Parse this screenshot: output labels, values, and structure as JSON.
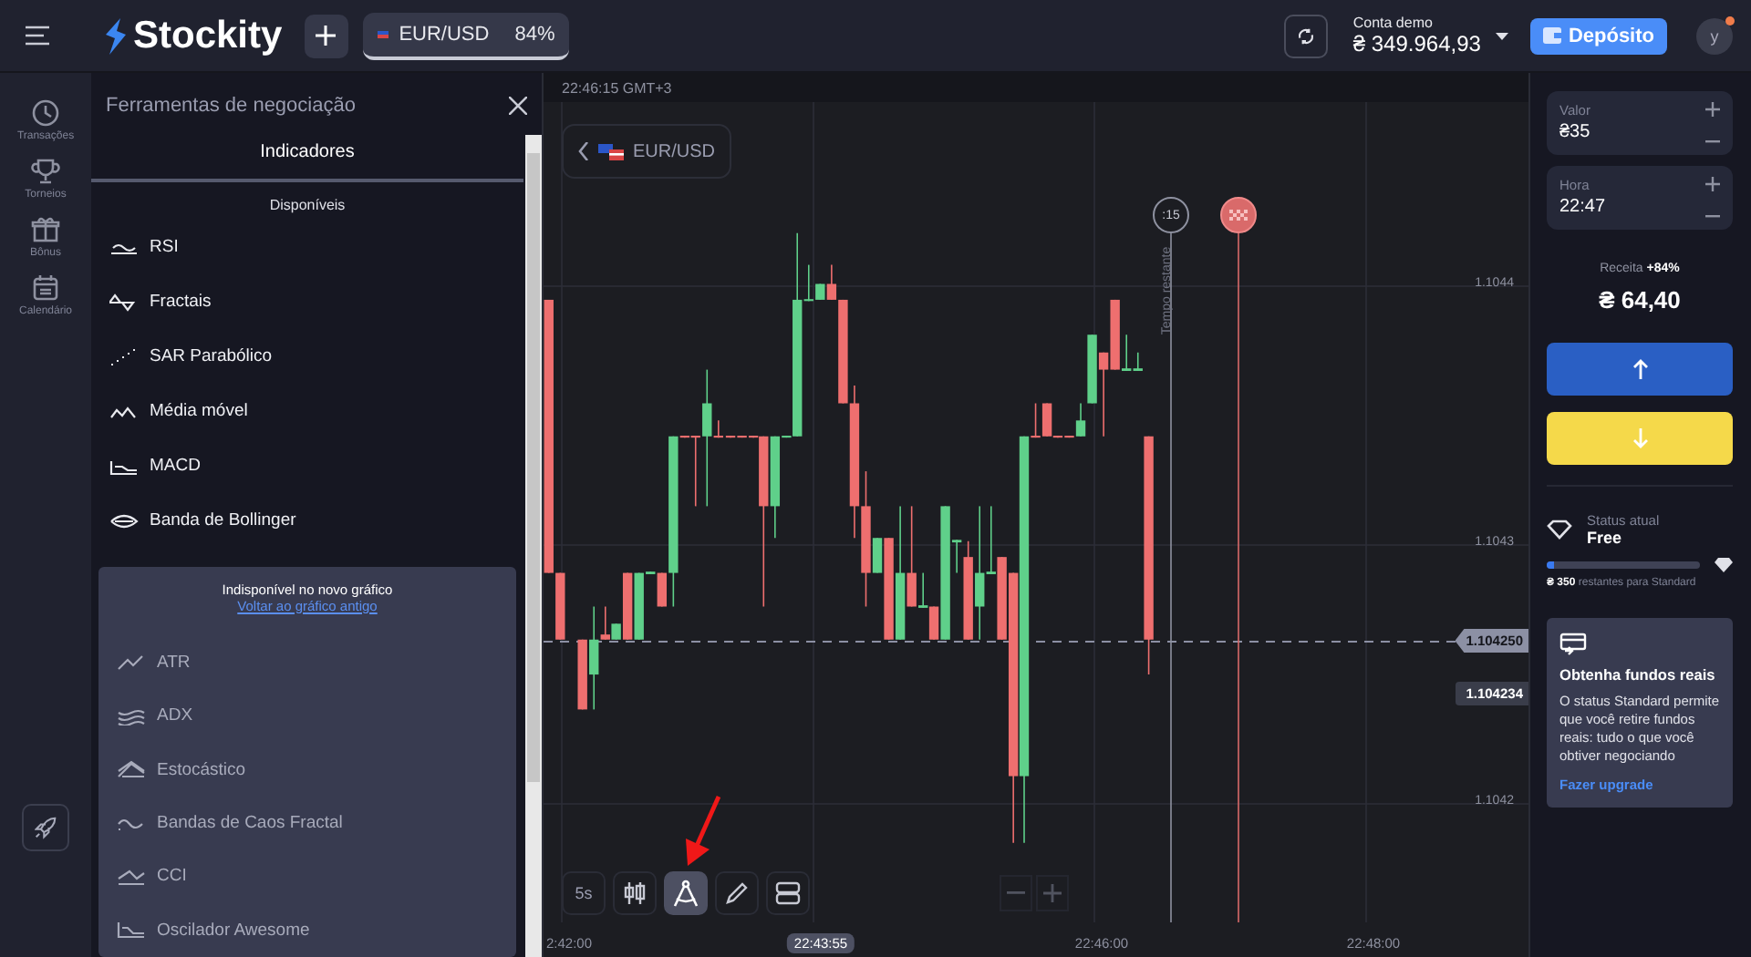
{
  "topbar": {
    "logo": "Stockity",
    "asset_tab": {
      "label": "EUR/USD",
      "payout": "84%",
      "selected": true
    },
    "account": {
      "label": "Conta demo",
      "balance": "₴ 349.964,93"
    },
    "deposit": "Depósito",
    "avatar": "y",
    "notification": true
  },
  "rail": {
    "items": [
      {
        "label": "Transações"
      },
      {
        "label": "Torneios"
      },
      {
        "label": "Bônus"
      },
      {
        "label": "Calendário"
      }
    ]
  },
  "tools_panel": {
    "title": "Ferramentas de negociação",
    "tabs": [
      {
        "label": "Indicadores",
        "selected": true
      }
    ],
    "section": "Disponíveis",
    "available": [
      {
        "label": "RSI"
      },
      {
        "label": "Fractais"
      },
      {
        "label": "SAR Parabólico"
      },
      {
        "label": "Média móvel"
      },
      {
        "label": "MACD"
      },
      {
        "label": "Banda de Bollinger"
      }
    ],
    "unavailable": {
      "title": "Indisponível no novo gráfico",
      "link": "Voltar ao gráfico antigo",
      "items": [
        {
          "label": "ATR"
        },
        {
          "label": "ADX"
        },
        {
          "label": "Estocástico"
        },
        {
          "label": "Bandas de Caos Fractal"
        },
        {
          "label": "CCI"
        },
        {
          "label": "Oscilador Awesome"
        }
      ]
    }
  },
  "chart": {
    "time_header": "22:46:15 GMT+3",
    "asset": "EUR/USD",
    "price_labels": [
      "1.1044",
      "1.1043",
      "1.1042"
    ],
    "current_price": "1.104250",
    "last_price": "1.104234",
    "timer": ":15",
    "timer_label": "Tempo restante",
    "time_labels": [
      {
        "label": "2:42:00",
        "highlighted": false
      },
      {
        "label": "22:43:55",
        "highlighted": true
      },
      {
        "label": "22:46:00",
        "highlighted": false
      },
      {
        "label": "22:48:00",
        "highlighted": false
      }
    ],
    "tools": [
      {
        "kind": "timeframe",
        "label": "5s",
        "selected": false
      },
      {
        "kind": "chart-type",
        "selected": false
      },
      {
        "kind": "drawing",
        "selected": true
      },
      {
        "kind": "pencil",
        "selected": false
      },
      {
        "kind": "layout",
        "selected": false
      }
    ]
  },
  "trade": {
    "amount": {
      "label": "Valor",
      "value": "₴35"
    },
    "time": {
      "label": "Hora",
      "value": "22:47"
    },
    "income_label": "Receita **+84%**",
    "income": "₴ 64,40",
    "status": {
      "label": "Status atual",
      "value": "Free",
      "level": 0.05,
      "remaining": "**₴ 350** restantes para Standard"
    },
    "promo": {
      "title": "Obtenha fundos reais",
      "text": "O status Standard permite que você retire fundos reais: tudo o que você obtiver negociando",
      "link": "Fazer upgrade"
    }
  }
}
